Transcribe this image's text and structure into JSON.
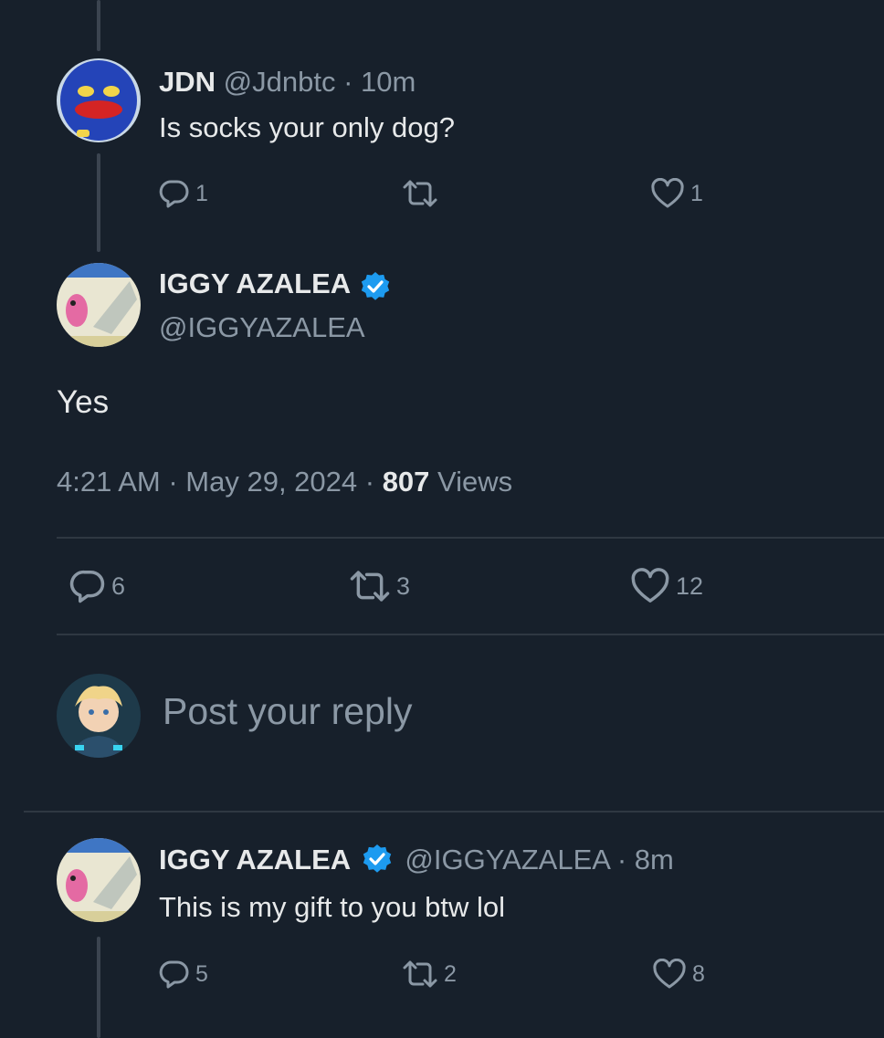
{
  "reply1": {
    "name": "JDN",
    "handle": "@Jdnbtc",
    "time": "· 10m",
    "text": "Is socks your only dog?",
    "replies": "1",
    "reposts": "",
    "likes": "1"
  },
  "main": {
    "name": "IGGY AZALEA",
    "handle": "@IGGYAZALEA",
    "text": "Yes",
    "timestamp": "4:21 AM · May 29, 2024 · ",
    "views_count": "807",
    "views_label": " Views",
    "replies": "6",
    "reposts": "3",
    "likes": "12"
  },
  "composer": {
    "placeholder": "Post your reply"
  },
  "reply2": {
    "name": "IGGY AZALEA",
    "handle": "@IGGYAZALEA",
    "time": "· 8m",
    "text": "This is my gift to you btw lol",
    "replies": "5",
    "reposts": "2",
    "likes": "8"
  },
  "icons": {
    "reply": "reply-icon",
    "repost": "repost-icon",
    "like": "heart-icon",
    "verified": "verified-badge-icon"
  },
  "colors": {
    "background": "#17202b",
    "text": "#e7e9ea",
    "muted": "#8b98a5",
    "verified": "#1d9bf0"
  }
}
